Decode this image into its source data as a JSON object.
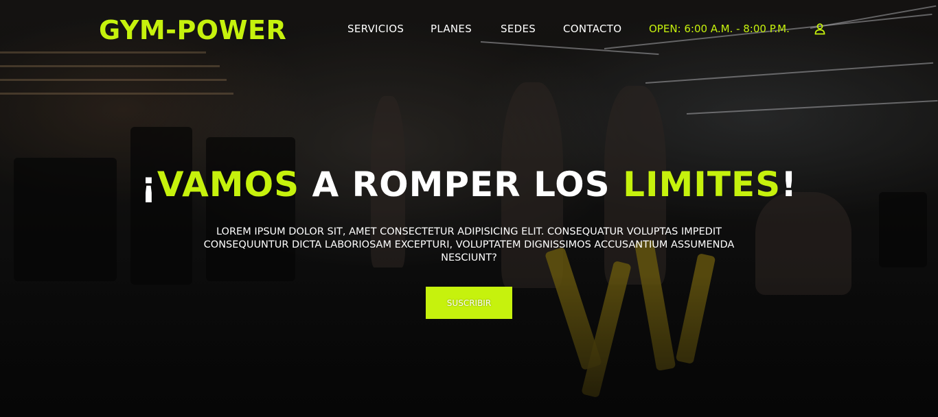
{
  "brand": {
    "logo": "GYM-POWER",
    "accent_color": "#c6f20d"
  },
  "nav": {
    "items": [
      "SERVICIOS",
      "PLANES",
      "SEDES",
      "CONTACTO"
    ],
    "hours": "OPEN: 6:00 A.M. - 8:00 P.M.",
    "user_icon": "user-icon"
  },
  "hero": {
    "headline": {
      "open_mark": "¡",
      "word1": "VAMOS",
      "middle": " A ROMPER LOS ",
      "word2": "LIMITES",
      "close_mark": "!"
    },
    "description": "LOREM IPSUM DOLOR SIT, AMET CONSECTETUR ADIPISICING ELIT. CONSEQUATUR VOLUPTAS IMPEDIT CONSEQUUNTUR DICTA LABORIOSAM EXCEPTURI, VOLUPTATEM DIGNISSIMOS ACCUSANTIUM ASSUMENDA NESCIUNT?",
    "cta_label": "SUSCRIBIR"
  }
}
